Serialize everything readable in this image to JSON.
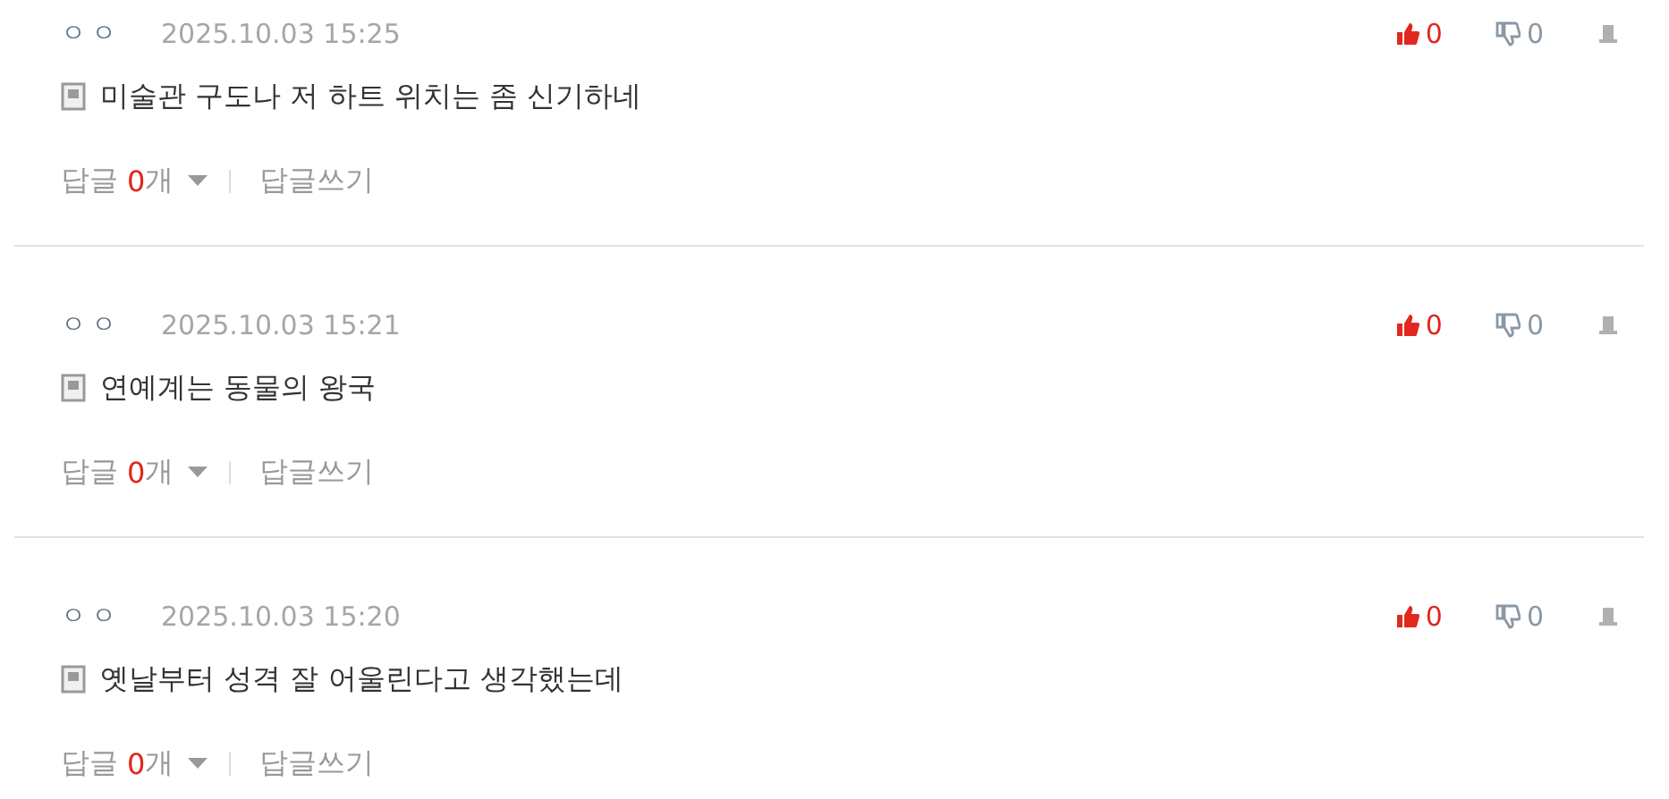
{
  "comments": [
    {
      "author": "ㅇㅇ",
      "date": "2025.10.03 15:25",
      "text": "미술관 구도나 저 하트 위치는 좀 신기하네",
      "likes": "0",
      "dislikes": "0",
      "reply_label": "답글",
      "reply_count": "0",
      "reply_unit": "개",
      "write_reply": "답글쓰기"
    },
    {
      "author": "ㅇㅇ",
      "date": "2025.10.03 15:21",
      "text": "연예계는 동물의 왕국",
      "likes": "0",
      "dislikes": "0",
      "reply_label": "답글",
      "reply_count": "0",
      "reply_unit": "개",
      "write_reply": "답글쓰기"
    },
    {
      "author": "ㅇㅇ",
      "date": "2025.10.03 15:20",
      "text": "옛날부터 성격 잘 어울린다고 생각했는데",
      "likes": "0",
      "dislikes": "0",
      "reply_label": "답글",
      "reply_count": "0",
      "reply_unit": "개",
      "write_reply": "답글쓰기"
    }
  ]
}
